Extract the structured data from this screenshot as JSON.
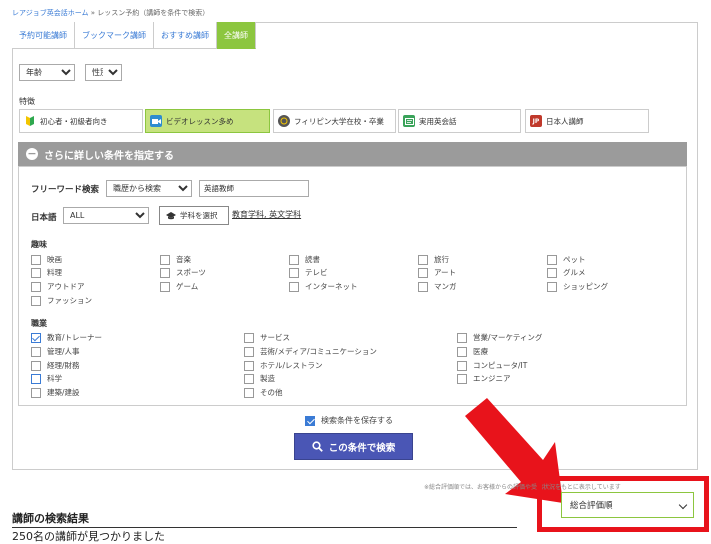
{
  "breadcrumb": {
    "home": "レアジョブ英会話ホーム",
    "sep": " » ",
    "current": "レッスン予約（講師を条件で検索）"
  },
  "tabs": [
    {
      "label": "予約可能講師"
    },
    {
      "label": "ブックマーク講師"
    },
    {
      "label": "おすすめ講師"
    },
    {
      "label": "全講師"
    }
  ],
  "filters": {
    "age": "年齢",
    "gender": "性別"
  },
  "features": {
    "label": "特徴",
    "items": [
      {
        "label": "初心者・初級者向き",
        "icon": "beginner-leaf-icon"
      },
      {
        "label": "ビデオレッスン多め",
        "icon": "video-camera-icon"
      },
      {
        "label": "フィリピン大学在校・卒業",
        "icon": "university-seal-icon"
      },
      {
        "label": "実用英会話",
        "icon": "conversation-icon"
      },
      {
        "label": "日本人講師",
        "icon": "jp-badge-icon"
      }
    ]
  },
  "detail": {
    "header": "さらに詳しい条件を指定する",
    "freeword_label": "フリーワード検索",
    "freeword_scope": "職歴から検索",
    "freeword_value": "英語教師",
    "japanese_label": "日本語",
    "japanese_value": "ALL",
    "subject_button": "学科を選択",
    "subject_selected": "教育学科, 英文学科"
  },
  "hobby": {
    "label": "趣味",
    "items": [
      "映画",
      "音楽",
      "読書",
      "旅行",
      "ペット",
      "料理",
      "スポーツ",
      "テレビ",
      "アート",
      "グルメ",
      "アウトドア",
      "ゲーム",
      "インターネット",
      "マンガ",
      "ショッピング",
      "ファッション"
    ]
  },
  "job": {
    "label": "職業",
    "items": [
      "教育/トレーナー",
      "サービス",
      "営業/マーケティング",
      "管理/人事",
      "芸術/メディア/コミュニケーション",
      "医療",
      "経理/財務",
      "ホテル/レストラン",
      "コンピュータ/IT",
      "科学",
      "製造",
      "エンジニア",
      "建築/建設",
      "その他"
    ]
  },
  "save_condition": "検索条件を保存する",
  "search_button": "この条件で検索",
  "note": "※総合評価順では、お客様からの評価や受講状況をもとに表示しています",
  "sort": {
    "value": "総合評価順"
  },
  "results": {
    "title": "講師の検索結果",
    "count": "250名の講師が見つかりました"
  },
  "colors": {
    "accent_green": "#8cc63f",
    "link_blue": "#3a7bd5",
    "button_indigo": "#4a56b5",
    "annotation_red": "#e8131b"
  }
}
